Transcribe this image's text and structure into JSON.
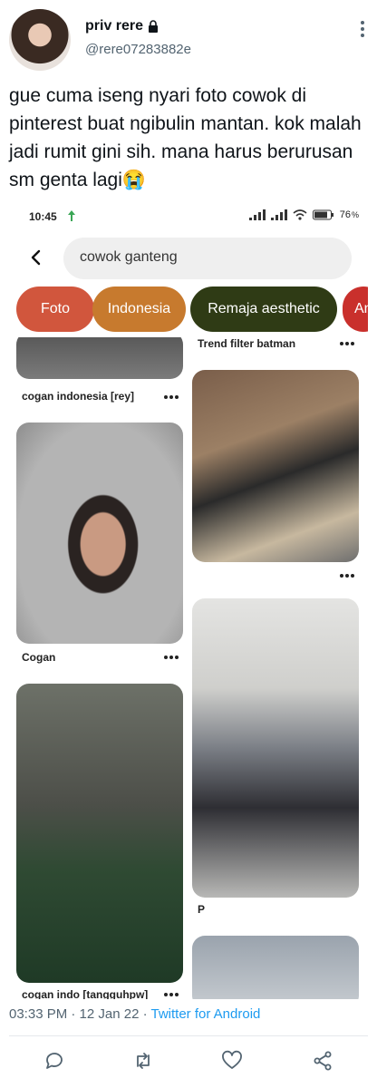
{
  "tweet": {
    "display_name": "priv rere",
    "handle": "@rere07283882e",
    "text": "gue cuma iseng nyari foto cowok di pinterest buat ngibulin mantan. kok malah jadi rumit gini sih. mana harus berurusan sm genta lagi😭",
    "timestamp": "03:33 PM · 12 Jan 22 · ",
    "source": "Twitter for Android"
  },
  "phone": {
    "status": {
      "time": "10:45",
      "battery": "76"
    },
    "search": {
      "query": "cowok ganteng"
    },
    "chips": [
      {
        "label": "Foto",
        "color": "#d1563d"
      },
      {
        "label": "Indonesia",
        "color": "#c77a2e"
      },
      {
        "label": "Remaja aesthetic",
        "color": "#2f3b15"
      },
      {
        "label": "Ani",
        "color": "#c9302c"
      }
    ],
    "pins": {
      "left": [
        "cogan indonesia [rey]",
        "Cogan",
        "cogan indo [tangguhpw]"
      ],
      "right": [
        "Trend filter batman",
        "P"
      ]
    }
  },
  "icons": {
    "lock": "lock-icon",
    "more": "more-vertical-icon",
    "reply": "reply-icon",
    "retweet": "retweet-icon",
    "like": "heart-icon",
    "share": "share-icon"
  }
}
